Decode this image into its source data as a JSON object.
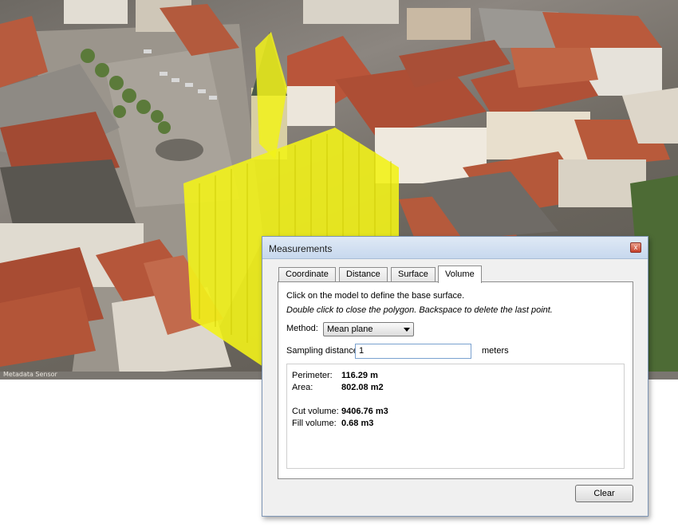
{
  "viewport": {
    "status_text": "Metadata  Sensor"
  },
  "dialog": {
    "title": "Measurements",
    "close_label": "x",
    "tabs": [
      {
        "label": "Coordinate"
      },
      {
        "label": "Distance"
      },
      {
        "label": "Surface"
      },
      {
        "label": "Volume",
        "active": true
      }
    ],
    "instruction": "Click on the model to define the base surface.",
    "hint": "Double click to close the polygon. Backspace to delete the last point.",
    "method": {
      "label": "Method:",
      "value": "Mean plane"
    },
    "sampling": {
      "label": "Sampling distance:",
      "value": "1",
      "unit": "meters"
    },
    "results": {
      "perimeter_label": "Perimeter:",
      "perimeter_value": "116.29 m",
      "area_label": "Area:",
      "area_value": "802.08 m2",
      "cut_label": "Cut volume:",
      "cut_value": "9406.76 m3",
      "fill_label": "Fill volume:",
      "fill_value": "0.68 m3"
    },
    "clear_label": "Clear"
  },
  "colors": {
    "highlight": "#f2f21a",
    "roof": "#b4553a",
    "accent_border": "#7aa1cf"
  }
}
